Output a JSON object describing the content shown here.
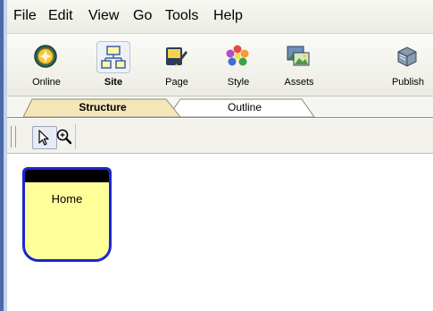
{
  "menu": [
    "File",
    "Edit",
    "View",
    "Go",
    "Tools",
    "Help"
  ],
  "toolbar": {
    "items": [
      {
        "label": "Online",
        "icon": "online-globe-icon"
      },
      {
        "label": "Site",
        "icon": "site-sitemap-icon",
        "active": true
      },
      {
        "label": "Page",
        "icon": "page-edit-icon"
      },
      {
        "label": "Style",
        "icon": "style-palette-icon"
      },
      {
        "label": "Assets",
        "icon": "assets-images-icon"
      },
      {
        "label": "Publish",
        "icon": "publish-server-icon"
      }
    ]
  },
  "view_tabs": [
    {
      "label": "Structure",
      "active": true
    },
    {
      "label": "Outline",
      "active": false
    }
  ],
  "view_tools": [
    {
      "icon": "pointer-arrow-icon",
      "active": true
    },
    {
      "icon": "zoom-icon",
      "active": false
    }
  ],
  "canvas": {
    "node": {
      "label": "Home"
    }
  },
  "colors": {
    "node_fill": "#ffff99",
    "node_border": "#1c26d4",
    "active_tab": "#f4e6b8"
  }
}
